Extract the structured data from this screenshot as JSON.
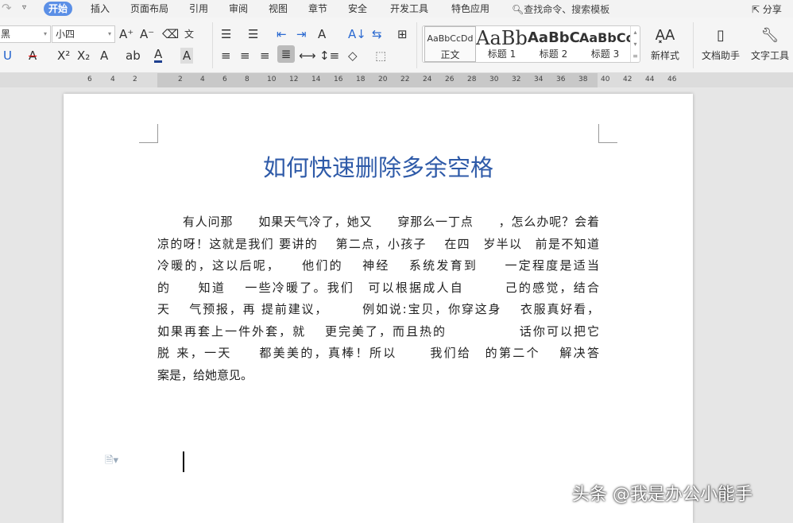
{
  "tabs": [
    "开始",
    "插入",
    "页面布局",
    "引用",
    "审阅",
    "视图",
    "章节",
    "安全",
    "开发工具",
    "特色应用"
  ],
  "search_placeholder": "查找命令、搜索模板",
  "share_label": "分享",
  "font_name": "黑",
  "font_size": "小四",
  "styles": [
    {
      "sample": "AaBbCcDd",
      "label": "正文"
    },
    {
      "sample": "AaBb",
      "label": "标题 1"
    },
    {
      "sample": "AaBbC",
      "label": "标题 2"
    },
    {
      "sample": "AaBbCc",
      "label": "标题 3"
    }
  ],
  "new_style_label": "新样式",
  "doc_assistant_label": "文档助手",
  "text_tools_label": "文字工具",
  "ruler_ticks_left": [
    "6",
    "4",
    "2"
  ],
  "ruler_ticks": [
    "2",
    "4",
    "6",
    "8",
    "10",
    "12",
    "14",
    "16",
    "18",
    "20",
    "22",
    "24",
    "26",
    "28",
    "30",
    "32",
    "34",
    "36",
    "38",
    "40",
    "42",
    "44",
    "46"
  ],
  "document": {
    "title": "如何快速删除多余空格",
    "lines": [
      "　　有人问那　　如果天气冷了，她又　　穿那么一丁点　　，怎么办呢？会着",
      "凉的呀！这就是我们 要讲的　 第二点，小孩子　 在四　岁半以　前是不知道",
      "冷暖的，这以后呢，　　他们的　 神经　 系统发育到　　一定程度是适当",
      "的　　知道　 一些冷暖了。我们　可以根据成人自　　　己的感觉，结合",
      "天　 气预报，再 提前建议，　　　例如说:宝贝，你穿这身　 衣服真好看，",
      "如果再套上一件外套，就　 更完美了，而且热的　　　　　 话你可以把它",
      "脱 来，一天　　都美美的，真棒！所以　　 我们给　的第二个　 解决答",
      "案是，给她意见。"
    ]
  },
  "watermark": "头条 @我是办公小能手"
}
